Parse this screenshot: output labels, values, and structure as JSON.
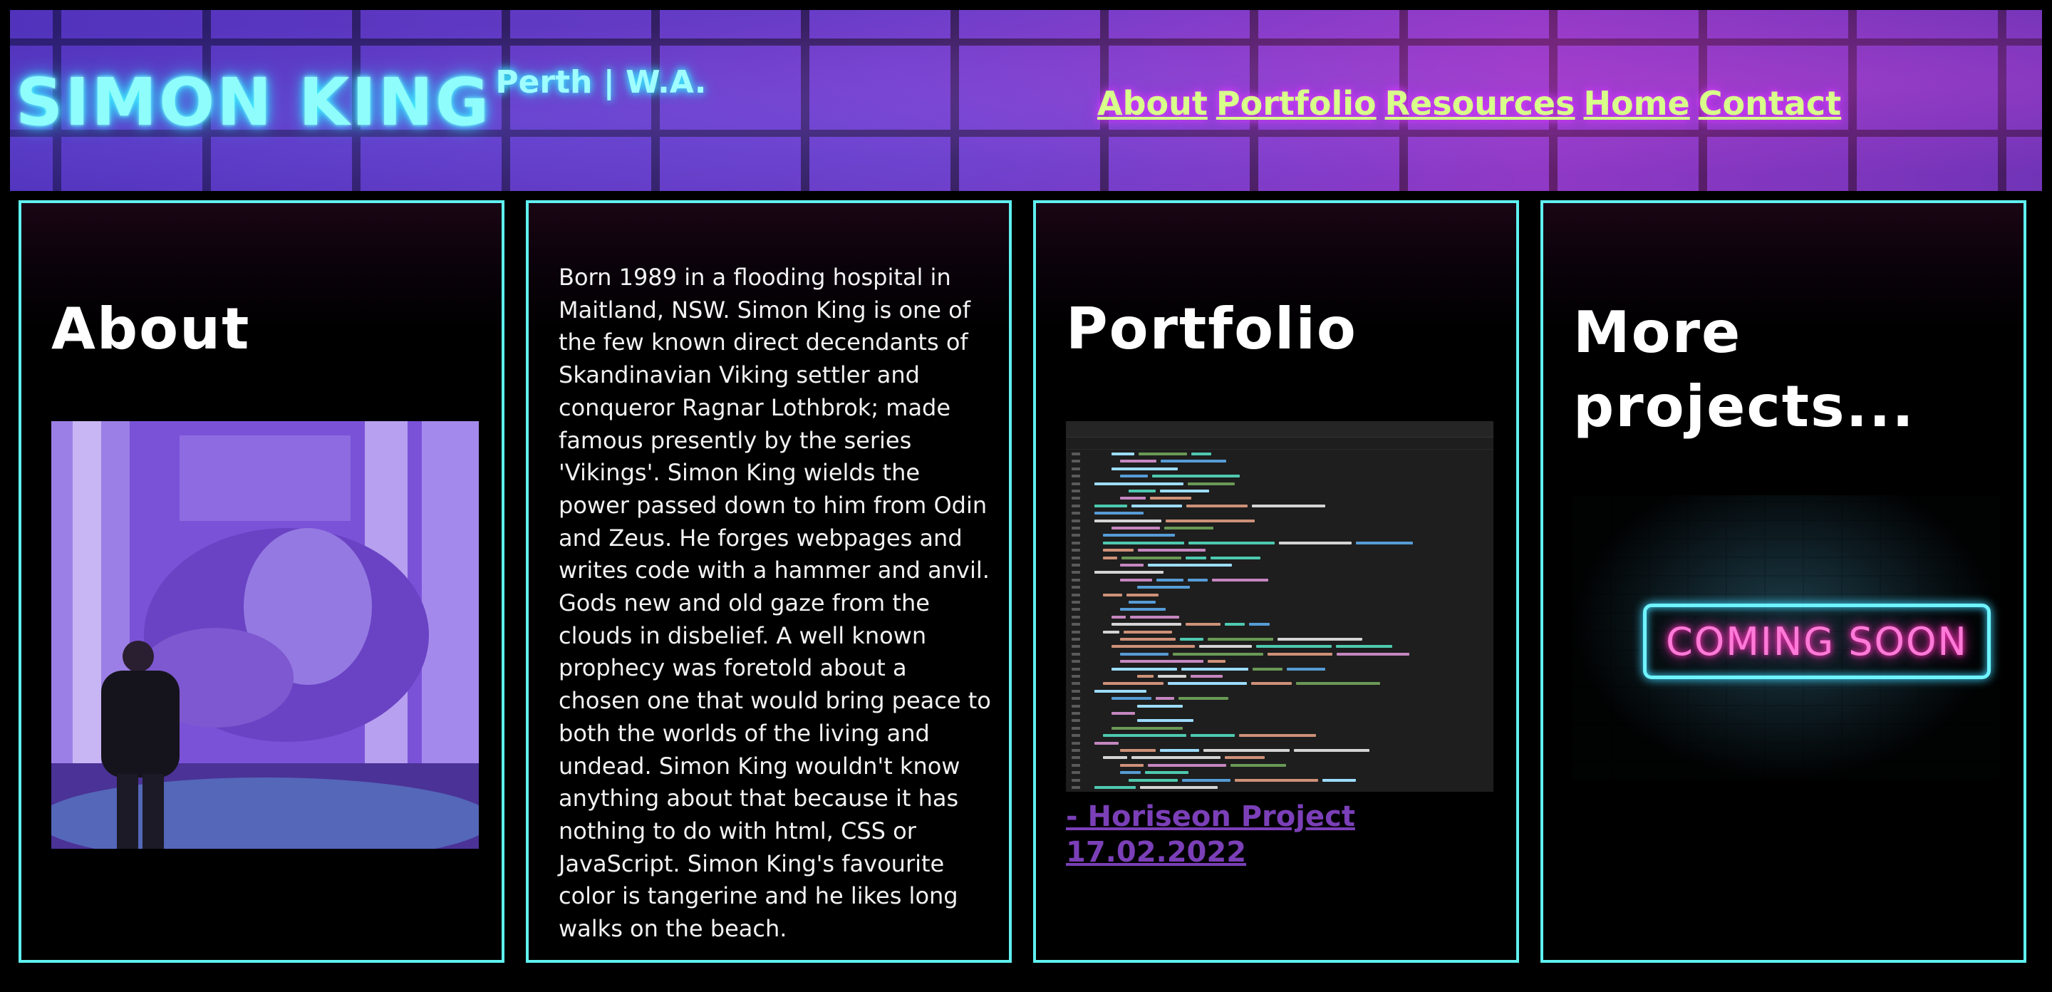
{
  "header": {
    "name": "SIMON KING",
    "location": "Perth | W.A.",
    "nav": [
      "About",
      "Portfolio",
      "Resources",
      "Home",
      "Contact"
    ]
  },
  "about": {
    "title": "About",
    "photo": "person-at-fountain-photo"
  },
  "bio": {
    "text": "Born 1989 in a flooding hospital in Maitland, NSW. Simon King is one of the few known direct decendants of Skandinavian Viking settler and conqueror Ragnar Lothbrok; made famous presently by the series 'Vikings'. Simon King wields the power passed down to him from Odin and Zeus. He forges webpages and writes code with a hammer and anvil. Gods new and old gaze from the clouds in disbelief. A well known prophecy was foretold about a chosen one that would bring peace to both the worlds of the living and undead. Simon King wouldn't know anything about that because it has nothing to do with html, CSS or JavaScript. Simon King's favourite color is tangerine and he likes long walks on the beach."
  },
  "portfolio": {
    "title": "Portfolio",
    "image": "code-editor-screenshot",
    "link_label": "- Horiseon Project 17.02.2022"
  },
  "more": {
    "title": "More projects...",
    "sign_text": "COMING SOON"
  },
  "colors": {
    "card_border": "#5ff0f0",
    "brand_glow": "#3ff0ff",
    "nav_text": "#d8ff8a",
    "nav_glow": "#e040ff",
    "project_link": "#7b3fb8",
    "sign_text": "#ff7ad8"
  }
}
